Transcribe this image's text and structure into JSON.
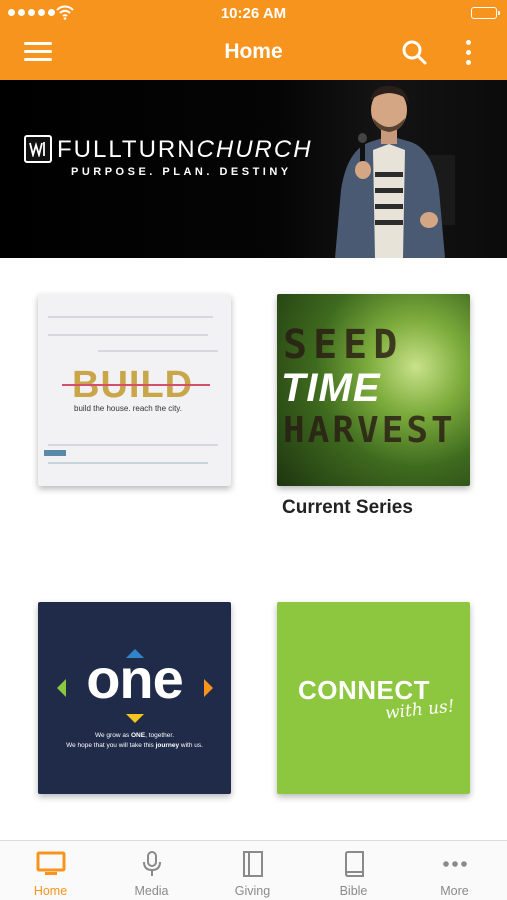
{
  "status_bar": {
    "time": "10:26 AM"
  },
  "nav": {
    "title": "Home"
  },
  "banner": {
    "name_bold": "FULLTURN",
    "name_italic": "CHURCH",
    "tagline": "PURPOSE. PLAN. DESTINY"
  },
  "tiles": {
    "build": {
      "title": "BUILD",
      "tagline": "build the house. reach the city."
    },
    "seed": {
      "line1": "SEED",
      "line2": "TIME",
      "line3": "HARVEST",
      "caption": "Current Series"
    },
    "one": {
      "title": "one",
      "sub1_a": "We grow as ",
      "sub1_b": "ONE",
      "sub1_c": ", together.",
      "sub2_a": "We hope that you will take this ",
      "sub2_b": "journey",
      "sub2_c": " with us."
    },
    "connect": {
      "title": "CONNECT",
      "script": "with us!"
    }
  },
  "tabs": [
    {
      "label": "Home",
      "icon": "tv-icon",
      "active": true
    },
    {
      "label": "Media",
      "icon": "microphone-icon"
    },
    {
      "label": "Giving",
      "icon": "giving-icon"
    },
    {
      "label": "Bible",
      "icon": "book-icon"
    },
    {
      "label": "More",
      "icon": "ellipsis-icon"
    }
  ],
  "colors": {
    "accent": "#f7941d",
    "tab_inactive": "#8a8a8a",
    "connect_green": "#8dc63f",
    "one_navy": "#1f2b49"
  }
}
